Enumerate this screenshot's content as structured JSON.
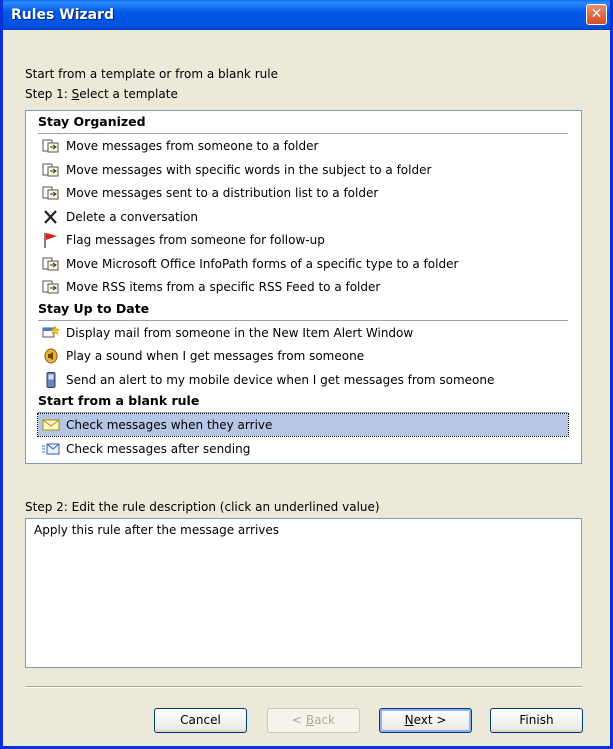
{
  "window": {
    "title": "Rules Wizard",
    "close_glyph": "✕"
  },
  "intro_text": "Start from a template or from a blank rule",
  "step1": {
    "prefix": "Step 1: ",
    "underlined_char": "S",
    "rest": "elect a template"
  },
  "groups": [
    {
      "title": "Stay Organized",
      "items": [
        {
          "label": "Move messages from someone to a folder",
          "icon": "move-folder-icon"
        },
        {
          "label": "Move messages with specific words in the subject to a folder",
          "icon": "move-folder-icon"
        },
        {
          "label": "Move messages sent to a distribution list to a folder",
          "icon": "move-folder-icon"
        },
        {
          "label": "Delete a conversation",
          "icon": "delete-x-icon"
        },
        {
          "label": "Flag messages from someone for follow-up",
          "icon": "flag-icon"
        },
        {
          "label": "Move Microsoft Office InfoPath forms of a specific type to a folder",
          "icon": "move-folder-icon"
        },
        {
          "label": "Move RSS items from a specific RSS Feed to a folder",
          "icon": "move-folder-icon"
        }
      ]
    },
    {
      "title": "Stay Up to Date",
      "items": [
        {
          "label": "Display mail from someone in the New Item Alert Window",
          "icon": "alert-window-icon"
        },
        {
          "label": "Play a sound when I get messages from someone",
          "icon": "speaker-icon"
        },
        {
          "label": "Send an alert to my mobile device when I get messages from someone",
          "icon": "mobile-icon"
        }
      ]
    },
    {
      "title": "Start from a blank rule",
      "items": [
        {
          "label": "Check messages when they arrive",
          "icon": "envelope-icon",
          "selected": true
        },
        {
          "label": "Check messages after sending",
          "icon": "sent-mail-icon"
        }
      ]
    }
  ],
  "step2": {
    "label": "Step 2: Edit the rule description (click an underlined value)",
    "description": "Apply this rule after the message arrives"
  },
  "buttons": {
    "cancel": "Cancel",
    "back": {
      "pre": "< ",
      "u": "B",
      "post": "ack"
    },
    "next": {
      "u": "N",
      "post": "ext >"
    },
    "finish": "Finish"
  },
  "colors": {
    "title_blue": "#0054e3",
    "selection": "#b6c6e5",
    "dialog_bg": "#ece9d8"
  }
}
